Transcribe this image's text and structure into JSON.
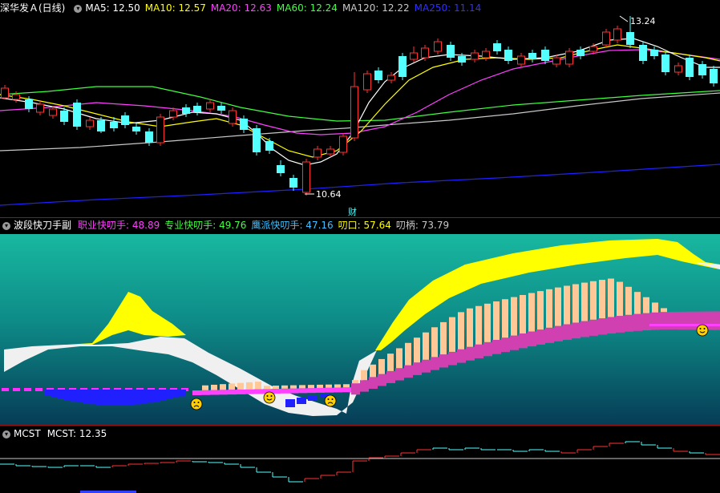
{
  "main_panel": {
    "title": "深华发Ａ(日线)",
    "ma": [
      {
        "label": "MA5: 12.50",
        "color": "#ffffff"
      },
      {
        "label": "MA10: 12.57",
        "color": "#ffff00"
      },
      {
        "label": "MA20: 12.63",
        "color": "#ff40ff"
      },
      {
        "label": "MA60: 12.24",
        "color": "#40ff40"
      },
      {
        "label": "MA120: 12.22",
        "color": "#c8c8c8"
      },
      {
        "label": "MA250: 11.14",
        "color": "#3030ff"
      }
    ],
    "high_marker": "13.24",
    "low_marker": "10.64",
    "finance_marker": "财"
  },
  "indicator_panel": {
    "name": "波段快刀手副",
    "items": [
      {
        "label": "职业快叨手: 48.89",
        "color": "#ff40ff"
      },
      {
        "label": "专业快叨手: 49.76",
        "color": "#40ff40"
      },
      {
        "label": "鹰派快叨手: 47.16",
        "color": "#40c0ff"
      },
      {
        "label": "叨口: 57.64",
        "color": "#ffff00"
      },
      {
        "label": "叨柄: 73.79",
        "color": "#c8c8c8"
      }
    ]
  },
  "mcst_panel": {
    "name": "MCST",
    "value_label": "MCST: 12.35"
  },
  "colors": {
    "up": "#ff3232",
    "down": "#54ffff",
    "separator": "#a01010"
  },
  "icons": [
    "chevron-down-icon",
    "smile-icon",
    "frown-icon"
  ]
}
